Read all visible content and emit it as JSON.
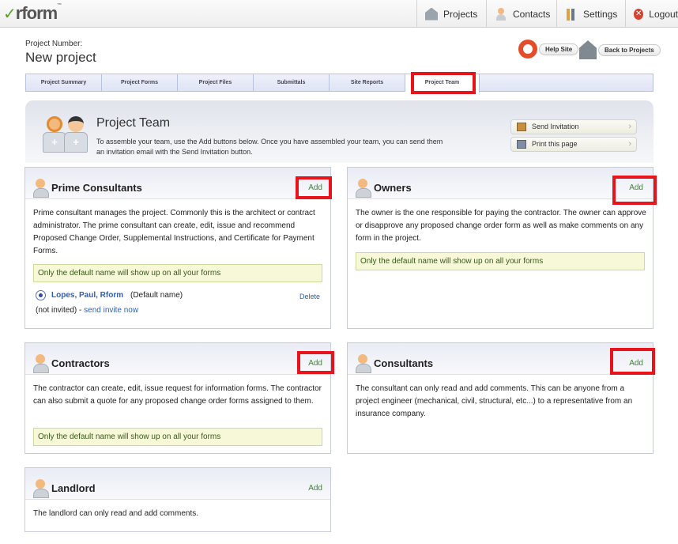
{
  "app": {
    "logo": "rform",
    "logo_tm": "™"
  },
  "nav": {
    "projects": "Projects",
    "contacts": "Contacts",
    "settings": "Settings",
    "logout": "Logout"
  },
  "project": {
    "number_label": "Project Number:",
    "name": "New project"
  },
  "header_buttons": {
    "help": "Help Site",
    "back": "Back to Projects"
  },
  "tabs": [
    {
      "label": "Project Summary"
    },
    {
      "label": "Project Forms"
    },
    {
      "label": "Project Files"
    },
    {
      "label": "Submittals"
    },
    {
      "label": "Site Reports"
    },
    {
      "label": "Project Team"
    }
  ],
  "active_tab": "Project Team",
  "intro": {
    "title": "Project Team",
    "text": "To assemble your team, use the Add buttons below. Once you have assembled your team, you can send them an invitation email with the Send Invitation button.",
    "send_invitation": "Send Invitation",
    "print_page": "Print this page"
  },
  "cards": {
    "prime": {
      "title": "Prime Consultants",
      "add": "Add",
      "desc": "Prime consultant manages the project. Commonly this is the architect or contract administrator. The prime consultant can create, edit, issue and recommend Proposed Change Order, Supplemental Instructions, and Certificate for Payment Forms.",
      "notice": "Only the default name will show up on all your forms",
      "member": {
        "name": "Lopes, Paul, Rform",
        "default_tag": "(Default name)",
        "delete": "Delete",
        "status": "(not invited) -",
        "invite": "send invite now"
      }
    },
    "owners": {
      "title": "Owners",
      "add": "Add",
      "desc": "The owner is the one responsible for paying the contractor. The owner can approve or disapprove any proposed change order form as well as make comments on any form in the project.",
      "notice": "Only the default name will show up on all your forms"
    },
    "contractors": {
      "title": "Contractors",
      "add": "Add",
      "desc": "The contractor can create, edit, issue request for information forms. The contractor can also submit a quote for any proposed change order forms assigned to them.",
      "notice": "Only the default name will show up on all your forms"
    },
    "consultants": {
      "title": "Consultants",
      "add": "Add",
      "desc": "The consultant can only read and add comments. This can be anyone from a project engineer (mechanical, civil, structural, etc...) to a representative from an insurance company."
    },
    "landlord": {
      "title": "Landlord",
      "add": "Add",
      "desc": "The landlord can only read and add comments."
    }
  },
  "colors": {
    "highlight": "#e8141c",
    "link": "#2f5fb5",
    "add_green": "#3a8a2c"
  }
}
